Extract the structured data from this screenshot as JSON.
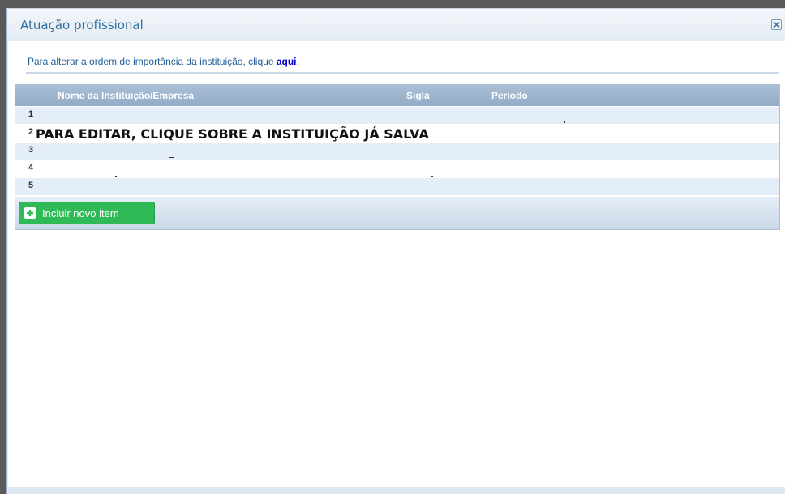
{
  "dialog": {
    "title": "Atuação profissional",
    "close_icon": "close-icon"
  },
  "hint": {
    "text": "Para alterar a ordem de importância da instituição, clique",
    "link": " aqui",
    "suffix": "."
  },
  "table": {
    "headers": [
      "Nome da Instituição/Empresa",
      "Sigla",
      "Período"
    ],
    "rows": [
      "1",
      "2",
      "3",
      "4",
      "5"
    ]
  },
  "overlay_text": "PARA EDITAR, CLIQUE SOBRE A INSTITUIÇÃO JÁ SALVA",
  "add_button": {
    "label": "Incluir novo item",
    "icon": "plus-icon"
  },
  "colors": {
    "title": "#2e6e9e",
    "header_bg": "#a9bfd6",
    "add_button": "#2fb957"
  }
}
